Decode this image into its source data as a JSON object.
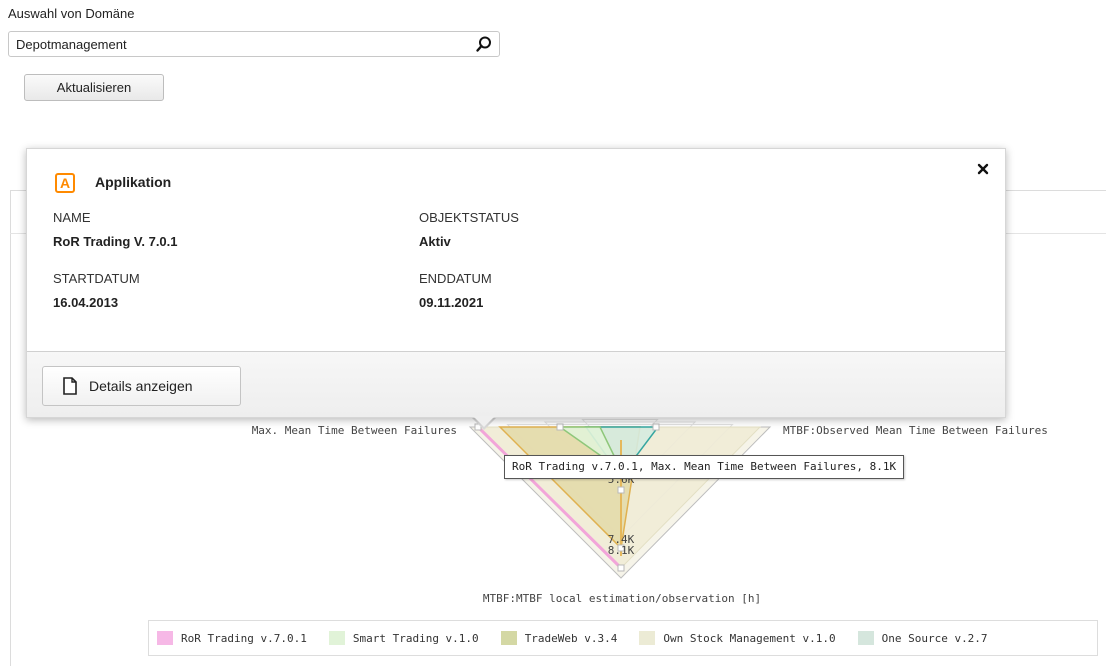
{
  "domain_selection": {
    "label": "Auswahl von Domäne",
    "value": "Depotmanagement",
    "search_icon": "search-icon"
  },
  "refresh_button": {
    "label": "Aktualisieren"
  },
  "popup": {
    "icon_letter": "A",
    "icon_color": "#ff8a00",
    "title": "Applikation",
    "close_icon": "close-icon",
    "fields": {
      "name_label": "NAME",
      "name_value": "RoR Trading V. 7.0.1",
      "status_label": "OBJEKTSTATUS",
      "status_value": "Aktiv",
      "start_label": "STARTDATUM",
      "start_value": "16.04.2013",
      "end_label": "ENDDATUM",
      "end_value": "09.11.2021"
    },
    "details_button": {
      "label": "Details anzeigen",
      "icon": "document-icon"
    }
  },
  "chart": {
    "axes": {
      "left": "Max. Mean Time Between Failures",
      "right": "MTBF:Observed Mean Time Between Failures",
      "bottom": "MTBF:MTBF local estimation/observation [h]"
    },
    "value_labels": [
      "5.6K",
      "7.4K",
      "8.1K"
    ],
    "tooltip": "RoR Trading v.7.0.1, Max. Mean Time Between Failures, 8.1K"
  },
  "chart_data": {
    "type": "radar",
    "axes": [
      "Max. Mean Time Between Failures",
      "MTBF:Observed Mean Time Between Failures",
      "MTBF:MTBF local estimation/observation [h]"
    ],
    "series": [
      {
        "name": "RoR Trading v.7.0.1",
        "color": "#f6b8e6",
        "values": [
          8100,
          null,
          8100
        ]
      },
      {
        "name": "Smart Trading v.1.0",
        "color": "#e1f3d8"
      },
      {
        "name": "TradeWeb v.3.4",
        "color": "#d4d8a4"
      },
      {
        "name": "Own Stock Management v.1.0",
        "color": "#ecebd5"
      },
      {
        "name": "One Source v.2.7",
        "color": "#d5e6dd"
      }
    ]
  },
  "legend": [
    {
      "label": "RoR Trading v.7.0.1",
      "color": "#f6b8e6"
    },
    {
      "label": "Smart Trading v.1.0",
      "color": "#e1f3d8"
    },
    {
      "label": "TradeWeb v.3.4",
      "color": "#d4d8a4"
    },
    {
      "label": "Own Stock Management v.1.0",
      "color": "#ecebd5"
    },
    {
      "label": "One Source v.2.7",
      "color": "#d5e6dd"
    }
  ]
}
